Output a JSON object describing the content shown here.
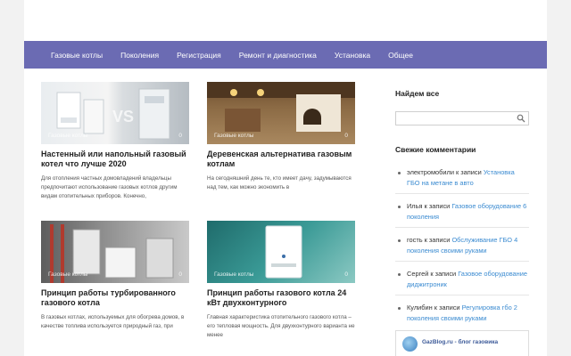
{
  "nav": {
    "items": [
      "Газовые котлы",
      "Поколения",
      "Регистрация",
      "Ремонт и диагностика",
      "Установка",
      "Общее"
    ]
  },
  "posts": [
    {
      "category": "Газовые котлы",
      "comments": "0",
      "title": "Настенный или напольный газовый котел что лучше 2020",
      "excerpt": "Для отопления частных домовладений владельцы предпочитают использование газовых котлов другим видам отопительных приборов. Конечно,"
    },
    {
      "category": "Газовые котлы",
      "comments": "0",
      "title": "Деревенская альтернатива газовым котлам",
      "excerpt": "На сегодняшний день те, кто имеет дачу, задумываются над тем, как можно экономить в"
    },
    {
      "category": "Газовые котлы",
      "comments": "0",
      "title": "Принцип работы турбированного газового котла",
      "excerpt": "В газовых котлах, используемых для обогрева домов, в качестве топлива используется природный газ, при"
    },
    {
      "category": "Газовые котлы",
      "comments": "0",
      "title": "Принцип работы газового котла 24 кВт двухконтурного",
      "excerpt": "Главная характеристика отопительного газового котла – его тепловая мощность. Для двухконтурного варианта не менее"
    }
  ],
  "sidebar": {
    "search_title": "Найдем все",
    "search_placeholder": "",
    "comments_title": "Свежие комментарии",
    "comments": [
      {
        "author": "электромобили",
        "sep": " к записи ",
        "link": "Установка ГБО на метане в авто"
      },
      {
        "author": "Илья",
        "sep": " к записи ",
        "link": "Газовое оборудование 6 поколения"
      },
      {
        "author": "гость",
        "sep": " к записи ",
        "link": "Обслуживание ГБО 4 поколения своими руками"
      },
      {
        "author": "Сергей",
        "sep": " к записи ",
        "link": "Газовое оборудование диджитроник"
      },
      {
        "author": "Кулибин",
        "sep": " к записи ",
        "link": "Регулировка гбо 2 поколения своими руками"
      }
    ],
    "widget_title": "GazBlog.ru - блог газовика"
  },
  "colors": {
    "nav_bg": "#6b6bb3",
    "link": "#3b8bd1",
    "page_bg": "#f2f2f2"
  }
}
